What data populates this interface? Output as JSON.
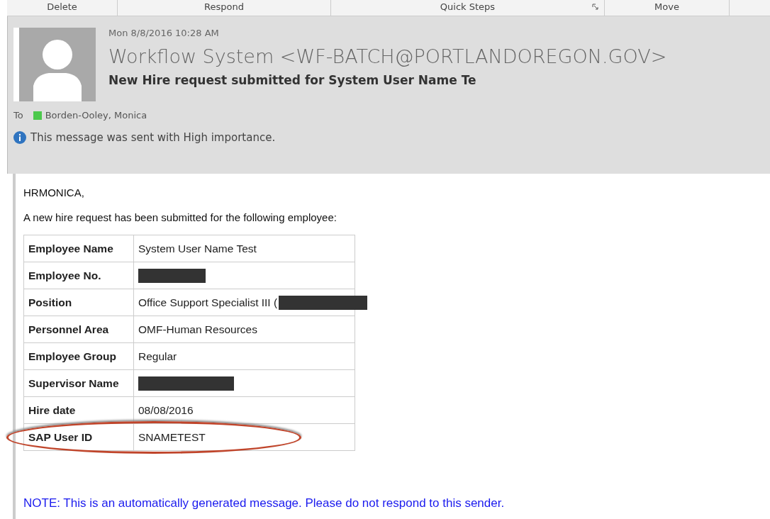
{
  "ribbon": {
    "groups": [
      {
        "label": "Delete",
        "launcher": false
      },
      {
        "label": "Respond",
        "launcher": false
      },
      {
        "label": "Quick Steps",
        "launcher": true
      },
      {
        "label": "Move",
        "launcher": false
      }
    ]
  },
  "header": {
    "date": "Mon 8/8/2016 10:28 AM",
    "sender": "Workflow System <WF-BATCH@PORTLANDOREGON.GOV>",
    "subject": "New Hire request submitted for System User Name Te",
    "to_label": "To",
    "recipient": "Borden-Ooley, Monica",
    "info": "This message was sent with High importance."
  },
  "body": {
    "greeting": "HRMONICA,",
    "intro": "A new hire request has been submitted for the following employee:",
    "rows": [
      {
        "label": "Employee Name",
        "value": "System User Name Test",
        "redacted": false,
        "circled": false
      },
      {
        "label": "Employee No.",
        "value": "",
        "redacted": true,
        "circled": false
      },
      {
        "label": "Position",
        "value": "Office Support Specialist III (",
        "redacted": true,
        "circled": false
      },
      {
        "label": "Personnel Area",
        "value": "OMF-Human Resources",
        "redacted": false,
        "circled": false
      },
      {
        "label": "Employee Group",
        "value": "Regular",
        "redacted": false,
        "circled": false
      },
      {
        "label": "Supervisor Name",
        "value": "",
        "redacted": true,
        "circled": false
      },
      {
        "label": "Hire date",
        "value": "08/08/2016",
        "redacted": false,
        "circled": false
      },
      {
        "label": "SAP User ID",
        "value": "SNAMETEST",
        "redacted": false,
        "circled": true
      }
    ],
    "note": "NOTE: This is an automatically generated message. Please do not respond to this sender."
  }
}
